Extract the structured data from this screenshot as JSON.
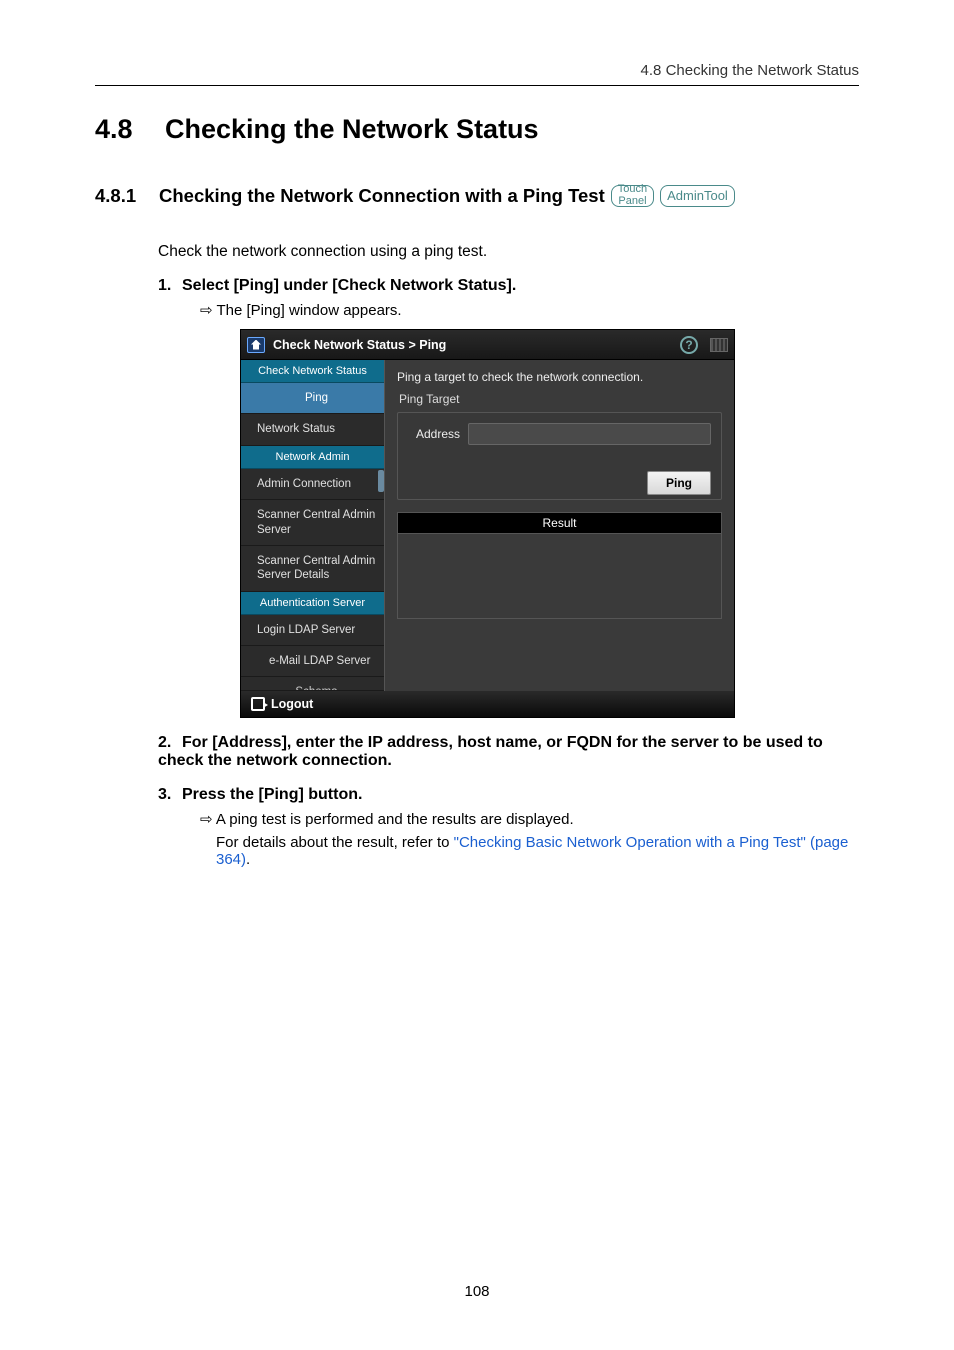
{
  "header": {
    "running_head": "4.8 Checking the Network Status"
  },
  "section": {
    "number": "4.8",
    "title": "Checking the Network Status"
  },
  "subsection": {
    "number": "4.8.1",
    "title": "Checking the Network Connection with a Ping Test",
    "badge_touch_l1": "Touch",
    "badge_touch_l2": "Panel",
    "badge_admin": "AdminTool"
  },
  "body": {
    "intro": "Check the network connection using a ping test.",
    "steps": [
      {
        "num": "1.",
        "text": "Select [Ping] under [Check Network Status]."
      },
      {
        "num": "2.",
        "text": "For [Address], enter the IP address, host name, or FQDN for the server to be used to check the network connection."
      },
      {
        "num": "3.",
        "text": "Press the [Ping] button."
      }
    ],
    "sub1": "The [Ping] window appears.",
    "sub3a": "A ping test is performed and the results are displayed.",
    "sub3b_prefix": "For details about the result, refer to ",
    "sub3b_link": "\"Checking Basic Network Operation with a Ping Test\" (page 364)",
    "sub3b_suffix": "."
  },
  "panel": {
    "breadcrumb": "Check Network Status > Ping",
    "help_glyph": "?",
    "sidebar": {
      "header1": "Check Network Status",
      "item_ping": "Ping",
      "item_net_status": "Network Status",
      "header2": "Network Admin",
      "item_admin_conn": "Admin Connection",
      "item_sc_admin": "Scanner Central Admin Server",
      "item_sc_details": "Scanner Central Admin Server Details",
      "header3": "Authentication Server",
      "item_login_ldap": "Login LDAP Server",
      "item_email_ldap": "e-Mail LDAP Server",
      "item_schema": "Schema"
    },
    "content": {
      "desc": "Ping a target to check the network connection.",
      "fieldset_label": "Ping Target",
      "address_label": "Address",
      "ping_button": "Ping",
      "result_header": "Result"
    },
    "logout": "Logout"
  },
  "page_number": "108"
}
